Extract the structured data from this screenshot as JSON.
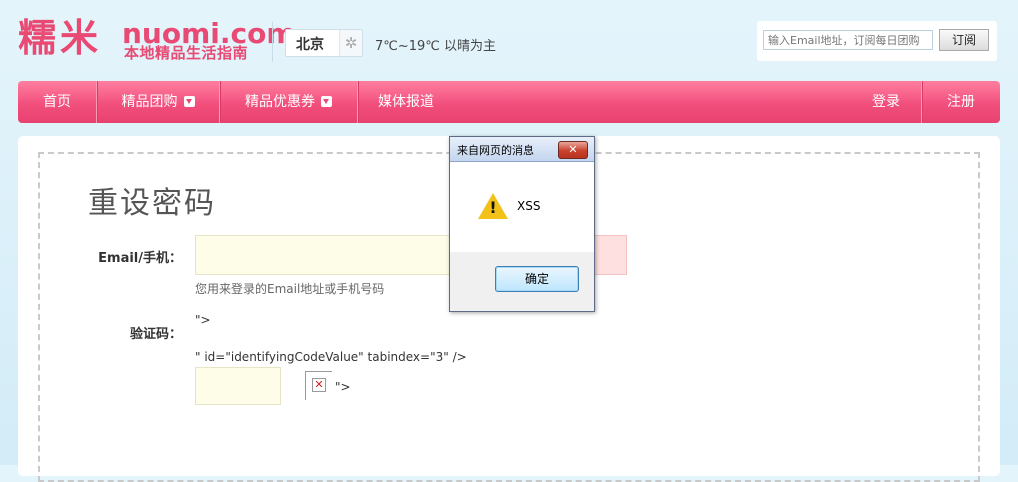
{
  "header": {
    "logo_cn": "糯米",
    "logo_en": "nuomi.com",
    "logo_sub": "本地精品生活指南",
    "city": "北京",
    "weather": "7℃~19℃  以晴为主",
    "subscribe_placeholder": "输入Email地址，订阅每日团购",
    "subscribe_button": "订阅"
  },
  "nav": {
    "items": [
      {
        "label": "首页",
        "dropdown": false
      },
      {
        "label": "精品团购",
        "dropdown": true
      },
      {
        "label": "精品优惠券",
        "dropdown": true
      },
      {
        "label": "媒体报道",
        "dropdown": false
      }
    ],
    "login": "登录",
    "register": "注册"
  },
  "form": {
    "title": "重设密码",
    "email_label": "Email/手机：",
    "email_value": "",
    "email_hint": "您用来登录的Email地址或手机号码",
    "code_label": "验证码：",
    "raw_text_1": "\">",
    "raw_text_2": "\" id=\"identifyingCodeValue\" tabindex=\"3\" />",
    "raw_text_3": "\">",
    "code_value": ""
  },
  "dialog": {
    "title": "来自网页的消息",
    "message": "XSS",
    "ok_button": "确定"
  },
  "colors": {
    "brand": "#e94a73",
    "nav_gradient_top": "#ff7fa0",
    "nav_gradient_bottom": "#e8426f"
  }
}
